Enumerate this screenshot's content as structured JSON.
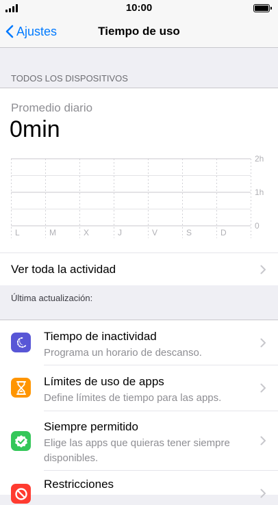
{
  "status_bar": {
    "time": "10:00"
  },
  "nav": {
    "back_label": "Ajustes",
    "title": "Tiempo de uso"
  },
  "section_all_devices": "TODOS LOS DISPOSITIVOS",
  "daily_average": {
    "label": "Promedio diario",
    "value": "0min"
  },
  "chart_data": {
    "type": "bar",
    "categories": [
      "L",
      "M",
      "X",
      "J",
      "V",
      "S",
      "D"
    ],
    "values": [
      0,
      0,
      0,
      0,
      0,
      0,
      0
    ],
    "y_tick_labels": [
      "0",
      "1h",
      "2h"
    ],
    "ylim": [
      0,
      2
    ],
    "grid": true
  },
  "see_all_activity": "Ver toda la actividad",
  "last_update": "Última actualización:",
  "settings": [
    {
      "title": "Tiempo de inactividad",
      "subtitle": "Programa un horario de descanso.",
      "icon": "downtime-icon",
      "color": "#5856d6"
    },
    {
      "title": "Límites de uso de apps",
      "subtitle": "Define límites de tiempo para las apps.",
      "icon": "hourglass-icon",
      "color": "#ff9500"
    },
    {
      "title": "Siempre permitido",
      "subtitle": "Elige las apps que quieras tener siempre disponibles.",
      "icon": "checkmark-shield-icon",
      "color": "#34c759"
    },
    {
      "title": "Restricciones",
      "subtitle": "",
      "icon": "restrictions-icon",
      "color": "#ff3b30"
    }
  ]
}
